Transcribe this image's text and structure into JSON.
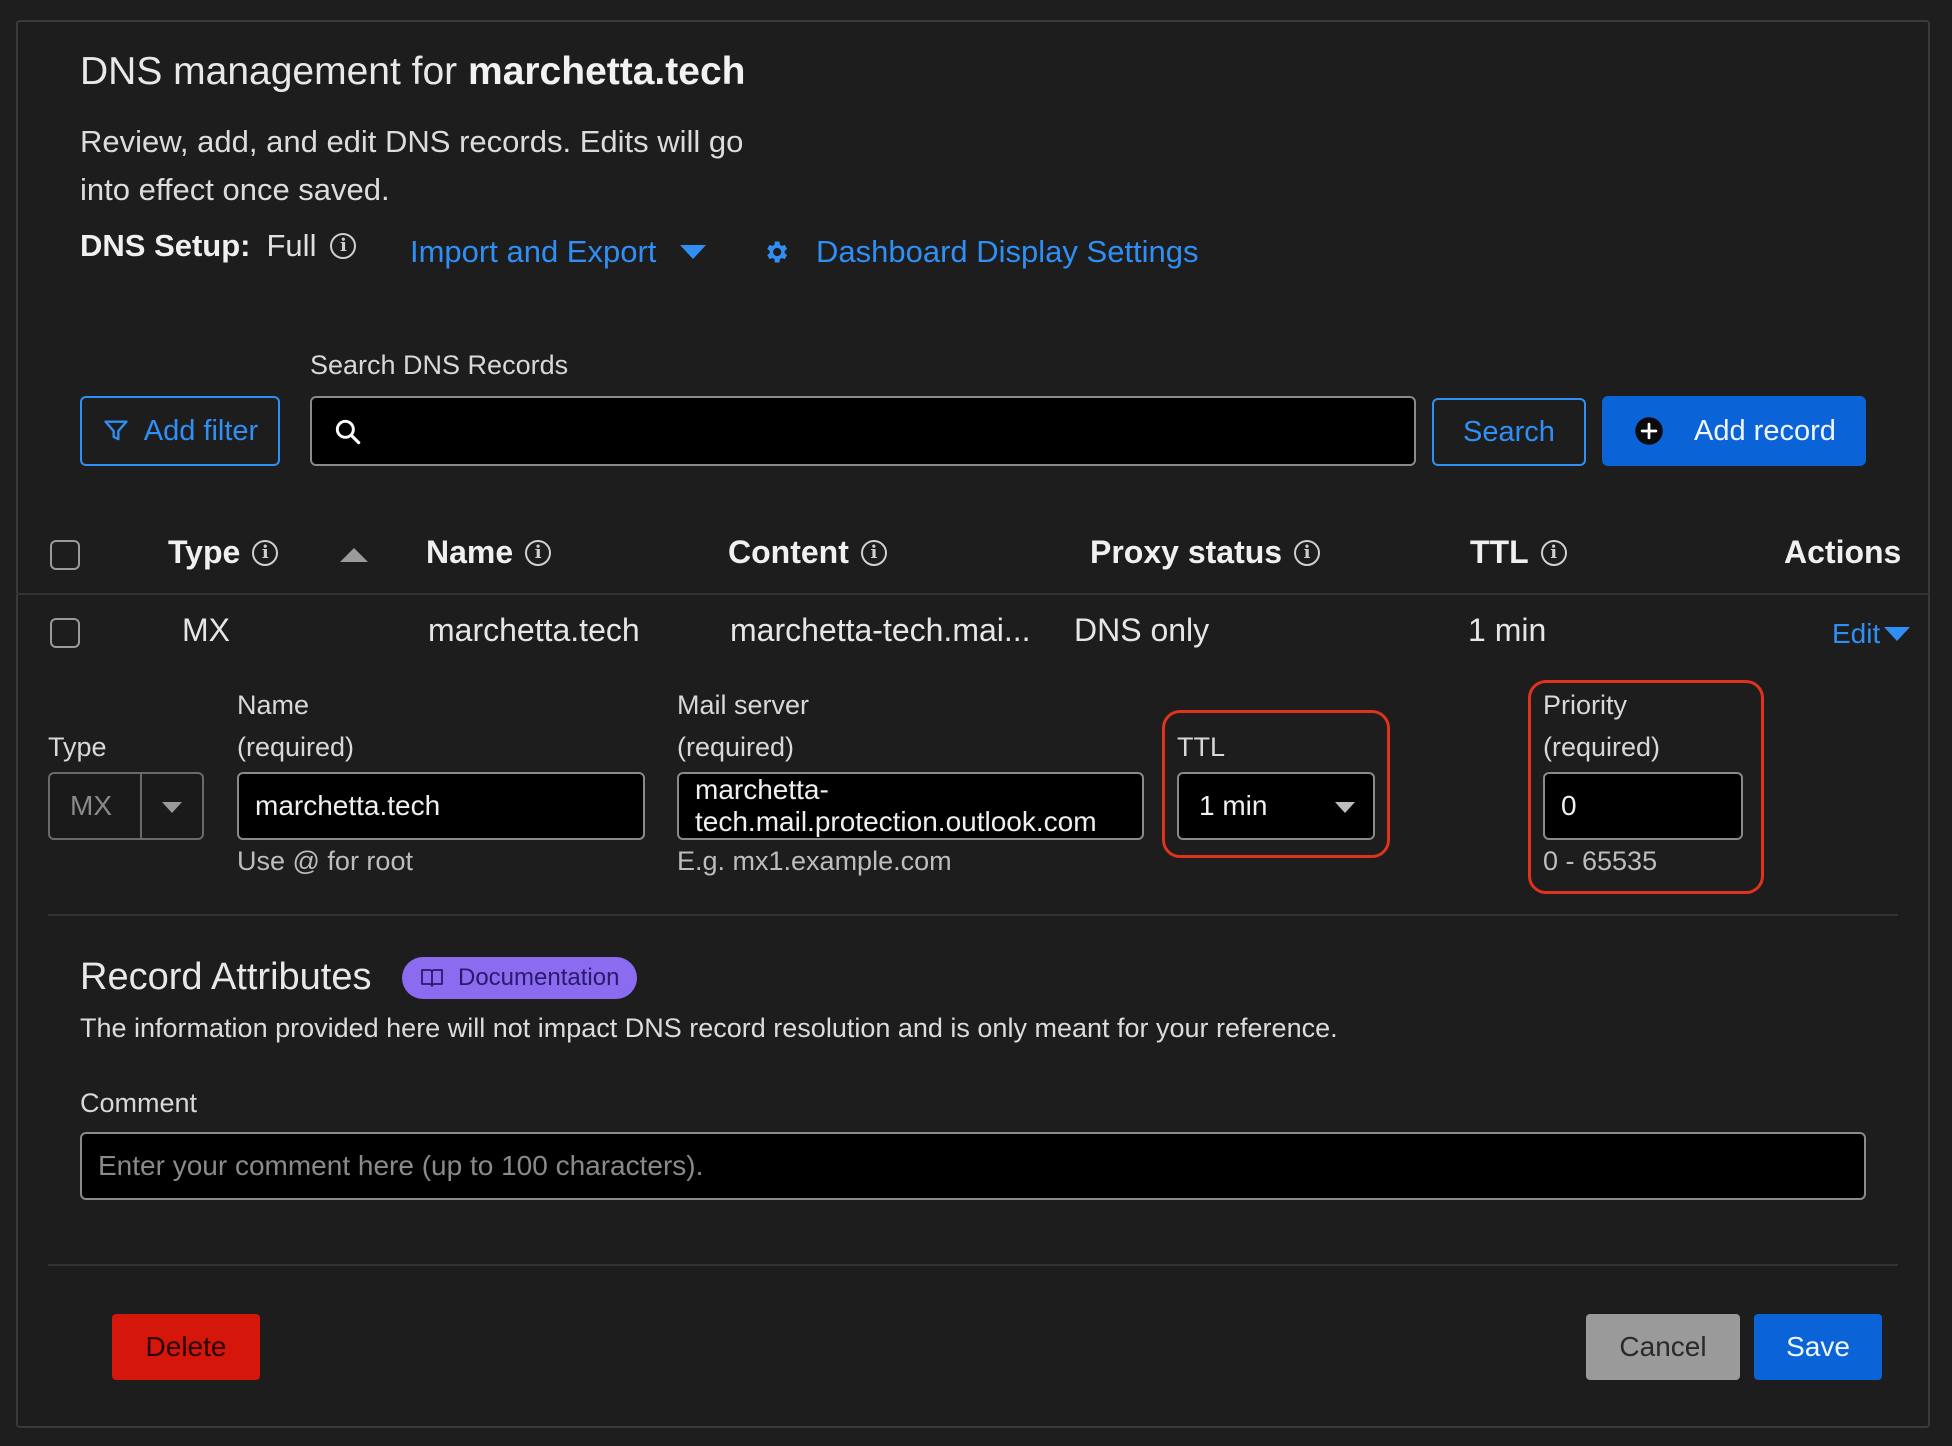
{
  "header": {
    "title_prefix": "DNS management for ",
    "domain": "marchetta.tech",
    "description": "Review, add, and edit DNS records. Edits will go into effect once saved.",
    "setup_label": "DNS Setup:",
    "setup_value": "Full",
    "import_export": "Import and Export",
    "display_settings": "Dashboard Display Settings"
  },
  "toolbar": {
    "add_filter": "Add filter",
    "search_label": "Search DNS Records",
    "search_value": "",
    "search_button": "Search",
    "add_record": "Add record"
  },
  "table": {
    "columns": [
      "Type",
      "Name",
      "Content",
      "Proxy status",
      "TTL",
      "Actions"
    ],
    "rows": [
      {
        "type": "MX",
        "name": "marchetta.tech",
        "content": "marchetta-tech.mai...",
        "proxy": "DNS only",
        "ttl": "1 min",
        "action": "Edit"
      }
    ]
  },
  "editor": {
    "type_label": "Type",
    "type_value": "MX",
    "name_label_1": "Name",
    "name_label_2": "(required)",
    "name_value": "marchetta.tech",
    "name_hint": "Use @ for root",
    "mail_label_1": "Mail server",
    "mail_label_2": "(required)",
    "mail_value_1": "marchetta-",
    "mail_value_2": "tech.mail.protection.outlook.com",
    "mail_hint": "E.g. mx1.example.com",
    "ttl_label": "TTL",
    "ttl_value": "1 min",
    "priority_label_1": "Priority",
    "priority_label_2": "(required)",
    "priority_value": "0",
    "priority_hint": "0 - 65535"
  },
  "attributes": {
    "title": "Record Attributes",
    "doc_badge": "Documentation",
    "note": "The information provided here will not impact DNS record resolution and is only meant for your reference.",
    "comment_label": "Comment",
    "comment_placeholder": "Enter your comment here (up to 100 characters)."
  },
  "footer": {
    "delete": "Delete",
    "cancel": "Cancel",
    "save": "Save"
  },
  "colors": {
    "accent": "#2f8ff5",
    "primary": "#0b63d8",
    "danger": "#d4160b",
    "highlight_ring": "#e0321c",
    "badge": "#8b6cf0"
  }
}
